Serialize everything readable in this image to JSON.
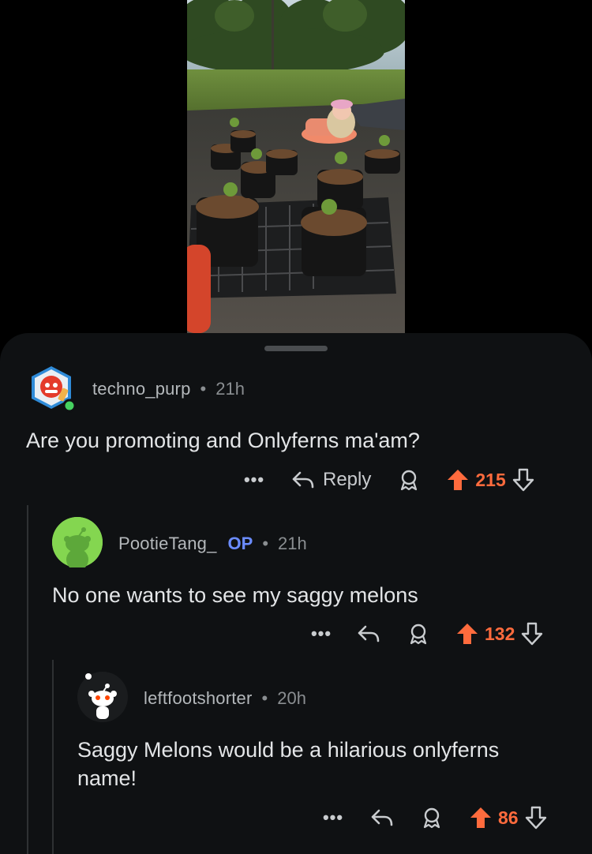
{
  "comments": [
    {
      "username": "techno_purp",
      "time": "21h",
      "body": "Are you promoting and Onlyferns ma'am?",
      "more": "•••",
      "reply_label": "Reply",
      "score": "215"
    },
    {
      "username": "PootieTang_",
      "badge": "OP",
      "time": "21h",
      "body": "No one wants to see my saggy melons",
      "more": "•••",
      "score": "132"
    },
    {
      "username": "leftfootshorter",
      "time": "20h",
      "body_line1": "Saggy Melons would be a hilarious onlyferns",
      "body_line2": "name!",
      "more": "•••",
      "score": "86"
    }
  ],
  "separator": "•",
  "colors": {
    "upvote": "#ff6b3d",
    "op_badge": "#6b8cff",
    "sheet_bg": "#0f1113",
    "online": "#46d160"
  },
  "icons": [
    "reply-arrow-icon",
    "award-icon",
    "upvote-arrow-icon",
    "downvote-arrow-icon",
    "more-dots-icon"
  ]
}
